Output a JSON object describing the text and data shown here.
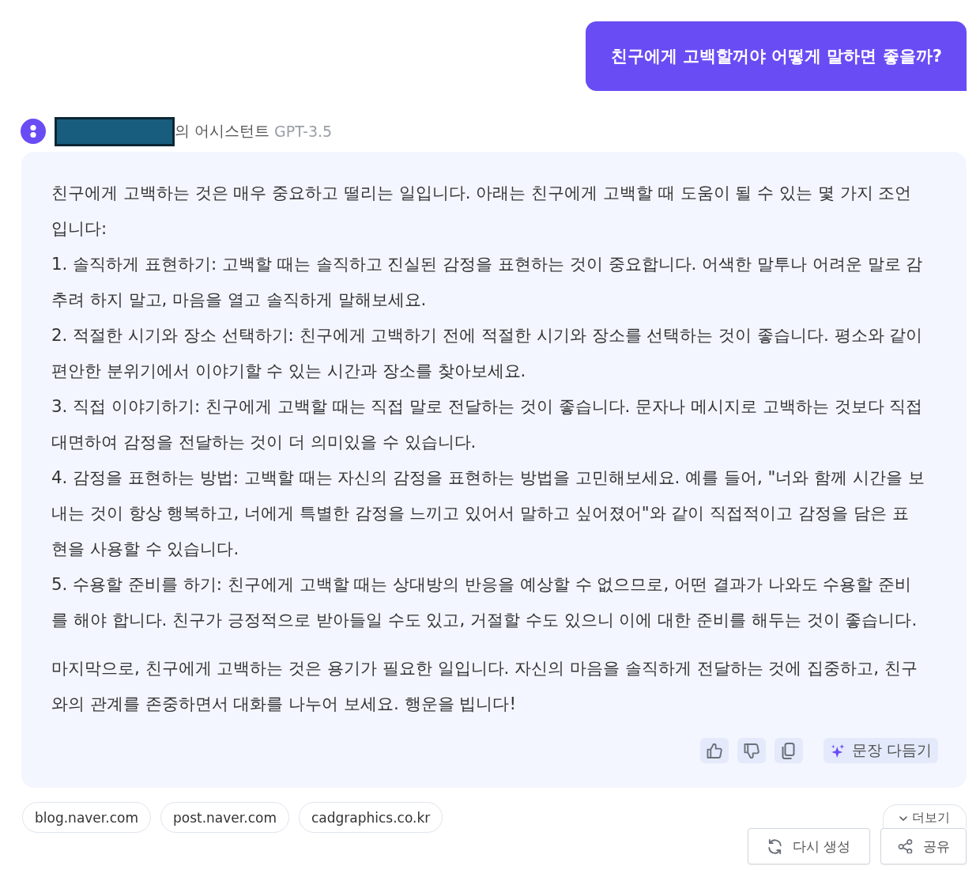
{
  "user_message": {
    "text": "친구에게 고백할꺼야 어떻게 말하면 좋을까?"
  },
  "assistant": {
    "name_redacted": true,
    "label": "의 어시스턴트",
    "model": "GPT-3.5"
  },
  "response": {
    "sections": [
      [
        "친구에게 고백하는 것은 매우 중요하고 떨리는 일입니다. 아래는 친구에게 고백할 때 도움이 될 수 있는 몇 가지 조언입니다:",
        "1. 솔직하게 표현하기: 고백할 때는 솔직하고 진실된 감정을 표현하는 것이 중요합니다. 어색한 말투나 어려운 말로 감추려 하지 말고, 마음을 열고 솔직하게 말해보세요.",
        "2. 적절한 시기와 장소 선택하기: 친구에게 고백하기 전에 적절한 시기와 장소를 선택하는 것이 좋습니다. 평소와 같이 편안한 분위기에서 이야기할 수 있는 시간과 장소를 찾아보세요.",
        "3. 직접 이야기하기: 친구에게 고백할 때는 직접 말로 전달하는 것이 좋습니다. 문자나 메시지로 고백하는 것보다 직접 대면하여 감정을 전달하는 것이 더 의미있을 수 있습니다.",
        "4. 감정을 표현하는 방법: 고백할 때는 자신의 감정을 표현하는 방법을 고민해보세요. 예를 들어, \"너와 함께 시간을 보내는 것이 항상 행복하고, 너에게 특별한 감정을 느끼고 있어서 말하고 싶어졌어\"와 같이 직접적이고 감정을 담은 표현을 사용할 수 있습니다.",
        "5. 수용할 준비를 하기: 친구에게 고백할 때는 상대방의 반응을 예상할 수 없으므로, 어떤 결과가 나와도 수용할 준비를 해야 합니다. 친구가 긍정적으로 받아들일 수도 있고, 거절할 수도 있으니 이에 대한 준비를 해두는 것이 좋습니다."
      ],
      [
        "마지막으로, 친구에게 고백하는 것은 용기가 필요한 일입니다. 자신의 마음을 솔직하게 전달하는 것에 집중하고, 친구와의 관계를 존중하면서 대화를 나누어 보세요. 행운을 빕니다!"
      ]
    ],
    "actions": [
      {
        "kind": "like"
      },
      {
        "kind": "dislike"
      },
      {
        "kind": "copy"
      },
      {
        "kind": "refine",
        "label": "문장 다듬기"
      }
    ]
  },
  "sources": [
    "blog.naver.com",
    "post.naver.com",
    "cadgraphics.co.kr"
  ],
  "more": {
    "label": "더보기"
  },
  "buttons": [
    {
      "kind": "regenerate",
      "label": "다시 생성"
    },
    {
      "kind": "share",
      "label": "공유"
    }
  ]
}
